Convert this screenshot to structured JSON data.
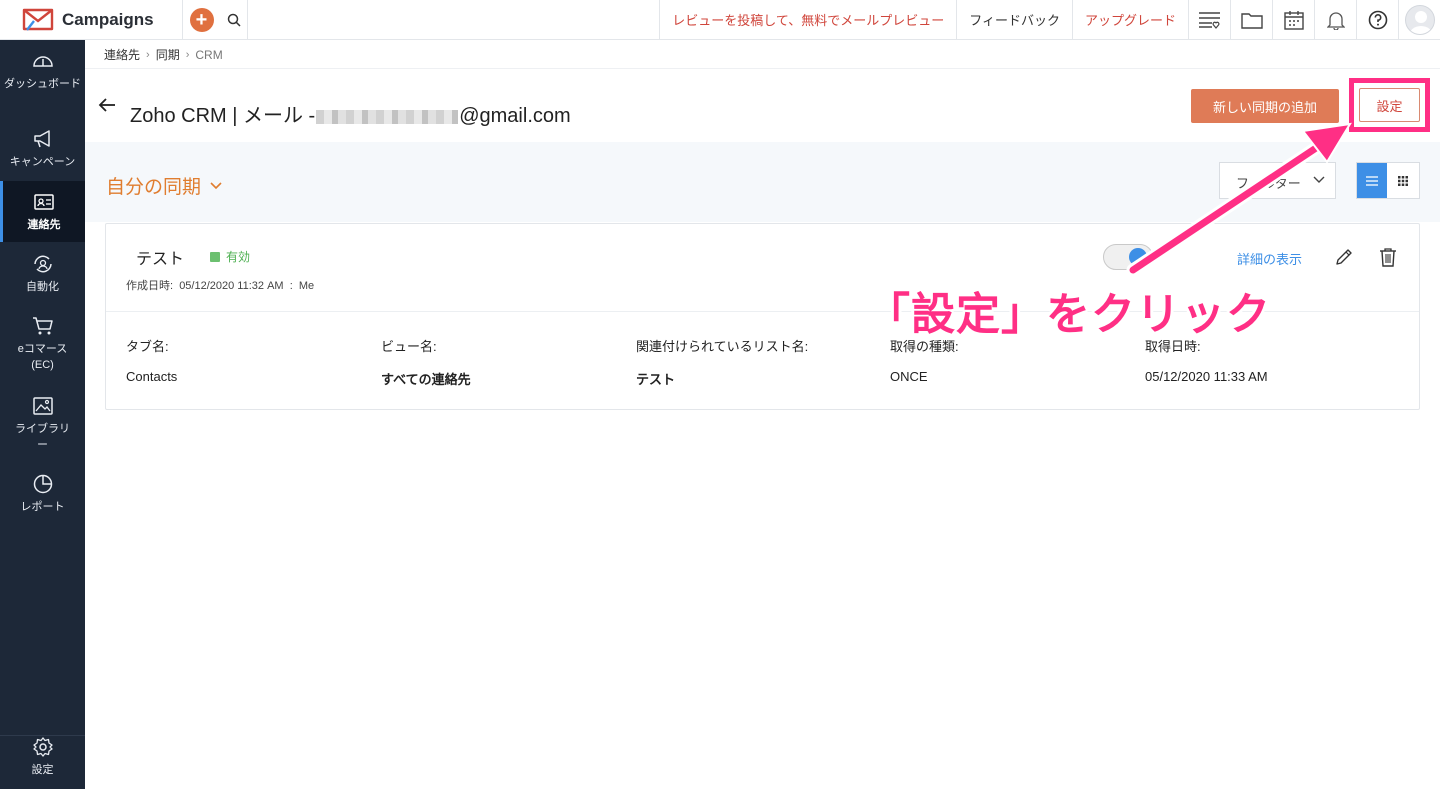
{
  "app": {
    "name": "Campaigns"
  },
  "topbar": {
    "review_link": "レビューを投稿して、無料でメールプレビュー",
    "feedback": "フィードバック",
    "upgrade": "アップグレード"
  },
  "sidebar": {
    "items": [
      {
        "label": "ダッシュボード",
        "icon": "dashboard-icon"
      },
      {
        "label": "キャンペーン",
        "icon": "megaphone-icon"
      },
      {
        "label": "連絡先",
        "icon": "contacts-icon",
        "active": true
      },
      {
        "label": "自動化",
        "icon": "automation-icon"
      },
      {
        "label": "eコマース(EC)",
        "icon": "cart-icon"
      },
      {
        "label": "ライブラリー",
        "icon": "library-icon"
      },
      {
        "label": "レポート",
        "icon": "report-icon"
      }
    ],
    "settings": "設定"
  },
  "breadcrumb": [
    "連絡先",
    "同期",
    "CRM"
  ],
  "header": {
    "title_prefix": "Zoho CRM | メール -",
    "title_suffix": "@gmail.com",
    "add_sync_button": "新しい同期の追加",
    "settings_button": "設定"
  },
  "section": {
    "title": "自分の同期",
    "filter_label": "フィルター"
  },
  "sync_card": {
    "name": "テスト",
    "status": "有効",
    "created_label": "作成日時:",
    "created_value": "05/12/2020 11:32 AM",
    "created_sep": ":",
    "created_by": "Me",
    "enabled": true,
    "details_link": "詳細の表示",
    "columns": [
      {
        "key": "タブ名:",
        "value": "Contacts",
        "bold": false
      },
      {
        "key": "ビュー名:",
        "value": "すべての連絡先",
        "bold": true
      },
      {
        "key": "関連付けられているリスト名:",
        "value": "テスト",
        "bold": true
      },
      {
        "key": "取得の種類:",
        "value": "ONCE",
        "bold": false
      },
      {
        "key": "取得日時:",
        "value": "05/12/2020 11:33 AM",
        "bold": false
      }
    ]
  },
  "annotation": {
    "text": "「設定」をクリック",
    "color": "#ff2f85"
  },
  "colors": {
    "accent": "#e07d2f",
    "primary_button": "#df7b57",
    "link": "#3d8fe6",
    "sidebar_bg": "#1d2838"
  }
}
